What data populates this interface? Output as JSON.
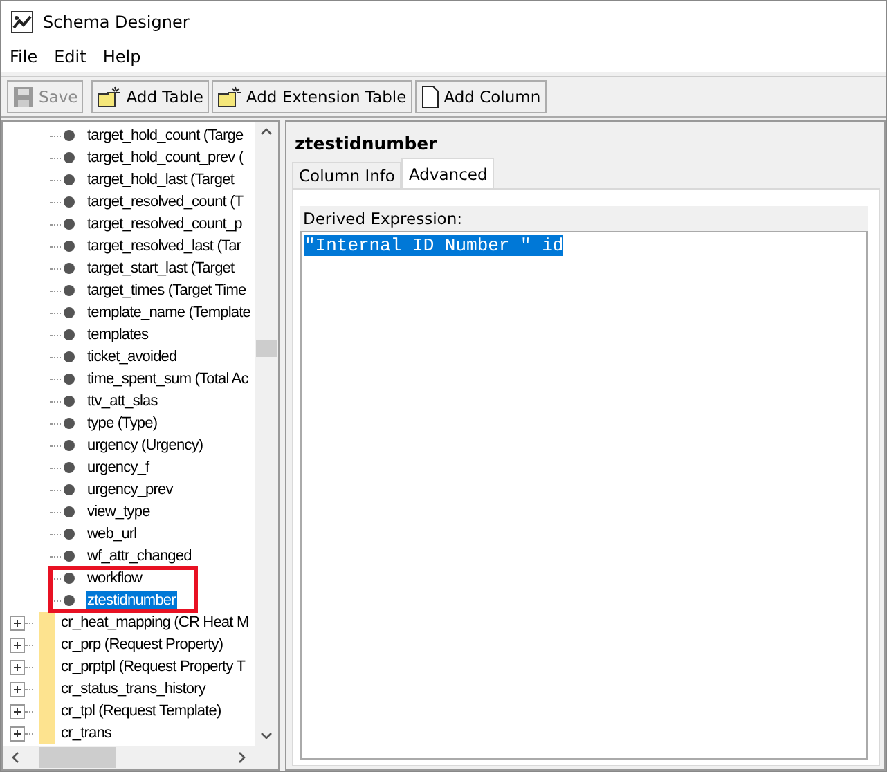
{
  "window": {
    "title": "Schema Designer"
  },
  "menu": [
    "File",
    "Edit",
    "Help"
  ],
  "toolbar": [
    {
      "label": "Save",
      "kind": "save",
      "disabled": true
    },
    {
      "label": "Add Table",
      "kind": "table",
      "disabled": false
    },
    {
      "label": "Add Extension Table",
      "kind": "table",
      "disabled": false
    },
    {
      "label": "Add Column",
      "kind": "column",
      "disabled": false
    }
  ],
  "tree": [
    {
      "kind": "column",
      "label": "target_hold_count (Targe",
      "selected": false
    },
    {
      "kind": "column",
      "label": "target_hold_count_prev (",
      "selected": false
    },
    {
      "kind": "column",
      "label": "target_hold_last (Target",
      "selected": false
    },
    {
      "kind": "column",
      "label": "target_resolved_count (T",
      "selected": false
    },
    {
      "kind": "column",
      "label": "target_resolved_count_p",
      "selected": false
    },
    {
      "kind": "column",
      "label": "target_resolved_last (Tar",
      "selected": false
    },
    {
      "kind": "column",
      "label": "target_start_last (Target",
      "selected": false
    },
    {
      "kind": "column",
      "label": "target_times (Target Time",
      "selected": false
    },
    {
      "kind": "column",
      "label": "template_name (Template",
      "selected": false
    },
    {
      "kind": "column",
      "label": "templates",
      "selected": false
    },
    {
      "kind": "column",
      "label": "ticket_avoided",
      "selected": false
    },
    {
      "kind": "column",
      "label": "time_spent_sum (Total Ac",
      "selected": false
    },
    {
      "kind": "column",
      "label": "ttv_att_slas",
      "selected": false
    },
    {
      "kind": "column",
      "label": "type (Type)",
      "selected": false
    },
    {
      "kind": "column",
      "label": "urgency (Urgency)",
      "selected": false
    },
    {
      "kind": "column",
      "label": "urgency_f",
      "selected": false
    },
    {
      "kind": "column",
      "label": "urgency_prev",
      "selected": false
    },
    {
      "kind": "column",
      "label": "view_type",
      "selected": false
    },
    {
      "kind": "column",
      "label": "web_url",
      "selected": false
    },
    {
      "kind": "column",
      "label": "wf_attr_changed",
      "selected": false
    },
    {
      "kind": "column",
      "label": "workflow",
      "selected": false
    },
    {
      "kind": "column",
      "label": "ztestidnumber",
      "selected": true
    },
    {
      "kind": "table",
      "label": "cr_heat_mapping (CR Heat M",
      "expanded": false,
      "selected": false
    },
    {
      "kind": "table",
      "label": "cr_prp (Request Property)",
      "expanded": false,
      "selected": false
    },
    {
      "kind": "table",
      "label": "cr_prptpl (Request Property T",
      "expanded": false,
      "selected": false
    },
    {
      "kind": "table",
      "label": "cr_status_trans_history",
      "expanded": false,
      "selected": false
    },
    {
      "kind": "table",
      "label": "cr_tpl (Request Template)",
      "expanded": false,
      "selected": false
    },
    {
      "kind": "table",
      "label": "cr_trans",
      "expanded": false,
      "selected": false
    }
  ],
  "detail": {
    "title": "ztestidnumber",
    "tabs": [
      {
        "label": "Column Info",
        "selected": false
      },
      {
        "label": "Advanced",
        "selected": true
      }
    ],
    "field_label": "Derived Expression:",
    "expression": "\"Internal ID Number \" id"
  }
}
